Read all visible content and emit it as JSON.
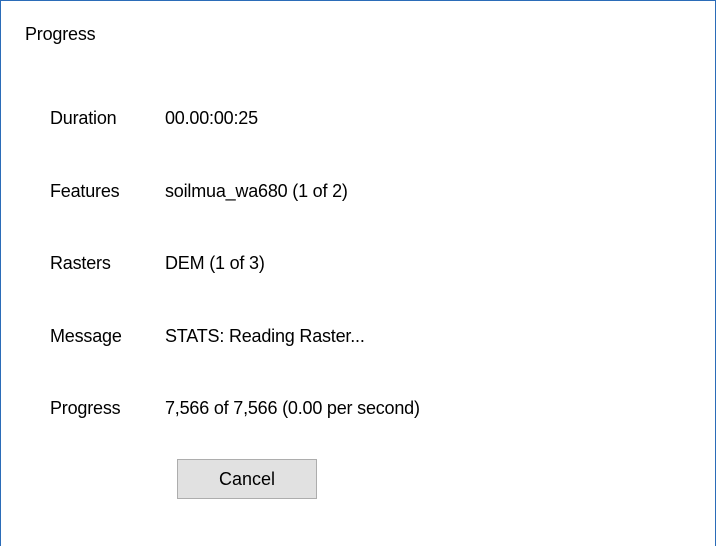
{
  "window": {
    "title": "Progress"
  },
  "fields": {
    "duration": {
      "label": "Duration",
      "value": "00.00:00:25"
    },
    "features": {
      "label": "Features",
      "value": "soilmua_wa680 (1 of 2)"
    },
    "rasters": {
      "label": "Rasters",
      "value": "DEM (1 of 3)"
    },
    "message": {
      "label": "Message",
      "value": "STATS: Reading Raster..."
    },
    "progress": {
      "label": "Progress",
      "value": "7,566 of 7,566 (0.00 per second)"
    }
  },
  "buttons": {
    "cancel_label": "Cancel"
  },
  "colors": {
    "window_border": "#2b6cb8",
    "button_background": "#e1e1e1",
    "button_border": "#adadad"
  }
}
